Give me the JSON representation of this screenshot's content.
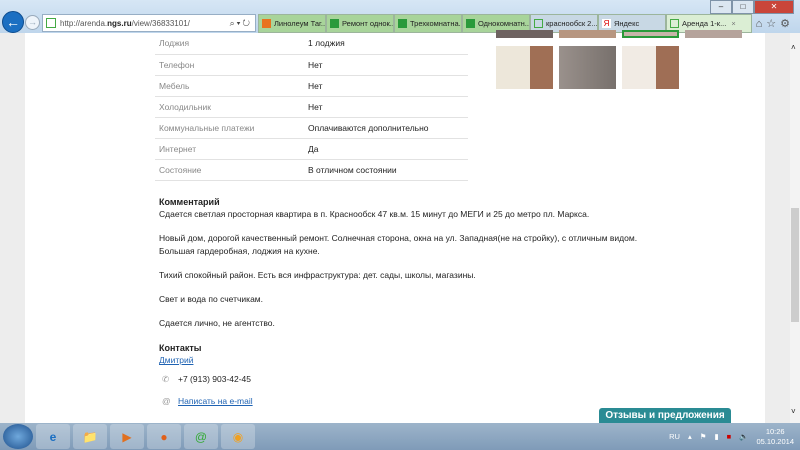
{
  "browser": {
    "url_prefix": "http://arenda.",
    "url_domain": "ngs.ru",
    "url_path": "/view/36833101/",
    "tabs": [
      {
        "label": "Линолеум Таг..."
      },
      {
        "label": "Ремонт однок..."
      },
      {
        "label": "Трехкомнатна..."
      },
      {
        "label": "Однокомнатн..."
      },
      {
        "label": "краснообск 2..."
      },
      {
        "label": "Яндекс"
      },
      {
        "label": "Аренда 1-к..."
      }
    ]
  },
  "details": [
    {
      "k": "Лоджия",
      "v": "1 лоджия"
    },
    {
      "k": "Телефон",
      "v": "Нет"
    },
    {
      "k": "Мебель",
      "v": "Нет"
    },
    {
      "k": "Холодильник",
      "v": "Нет"
    },
    {
      "k": "Коммунальные платежи",
      "v": "Оплачиваются дополнительно"
    },
    {
      "k": "Интернет",
      "v": "Да"
    },
    {
      "k": "Состояние",
      "v": "В отличном состоянии"
    }
  ],
  "comment": {
    "title": "Комментарий",
    "p": [
      "Сдается светлая просторная квартира в п. Краснообск 47 кв.м. 15 минут до МЕГИ и 25 до метро пл. Маркса.",
      "Новый дом, дорогой качественный ремонт. Солнечная сторона, окна на ул. Западная(не на стройку), с отличным видом.",
      "Большая гардеробная, лоджия на кухне.",
      "Тихий спокойный район. Есть вся инфраструктура: дет. сады, школы, магазины.",
      "Свет и вода по счетчикам.",
      "Сдается лично, не агентство."
    ]
  },
  "contacts": {
    "title": "Контакты",
    "name": "Дмитрий",
    "phone": "+7 (913) 903-42-45",
    "email_link": "Написать на e-mail"
  },
  "feedback": "Отзывы и предложения",
  "tray": {
    "lang": "RU",
    "time": "10:26",
    "date": "05.10.2014"
  }
}
